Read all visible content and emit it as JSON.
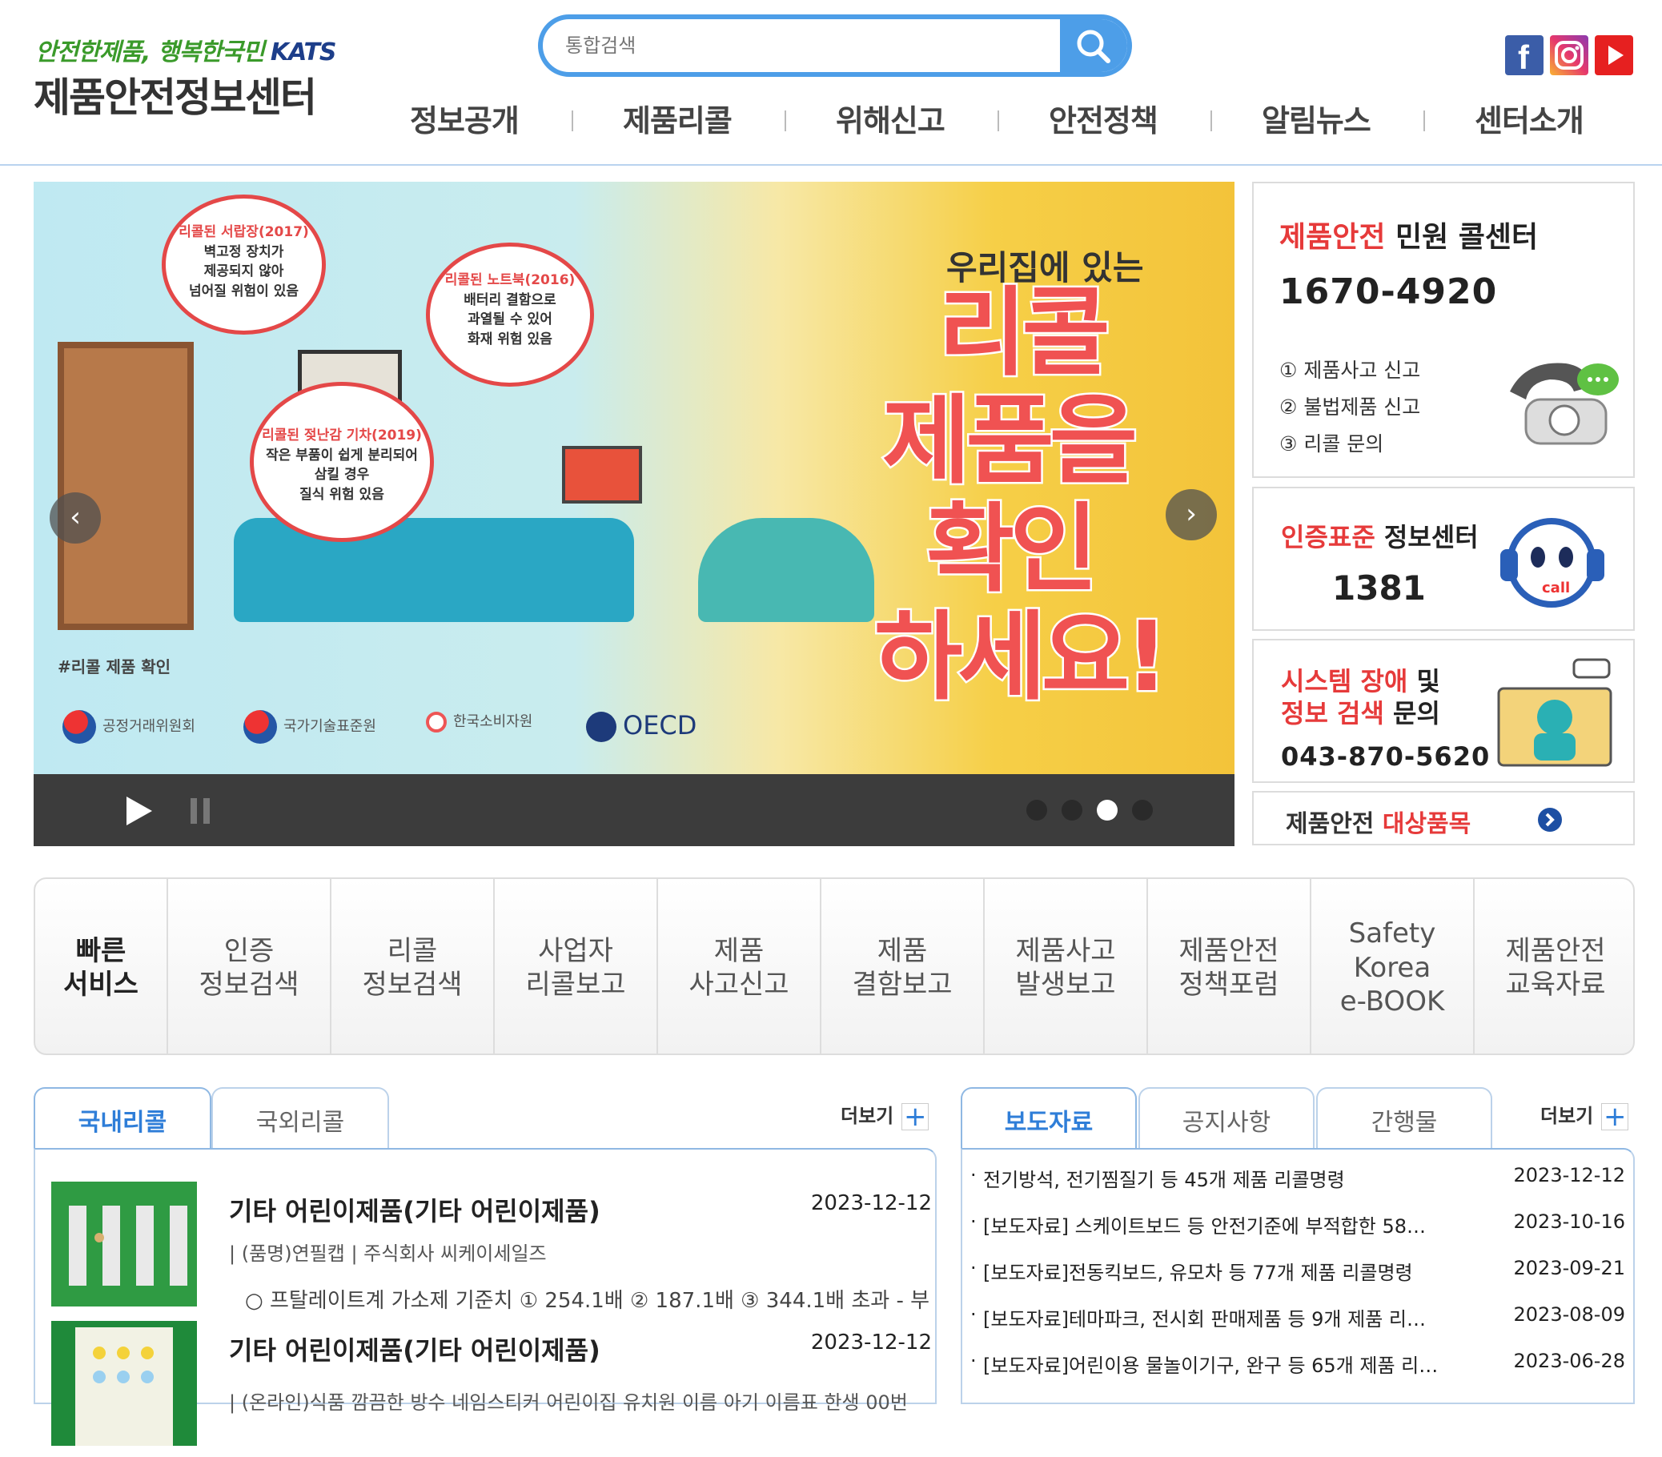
{
  "header": {
    "slogan": "안전한제품, 행복한국민",
    "slogan_brand": "KATS",
    "site_name": "제품안전정보센터",
    "search_placeholder": "통합검색",
    "sns": [
      "facebook-icon",
      "instagram-icon",
      "youtube-icon"
    ],
    "nav": [
      "정보공개",
      "제품리콜",
      "위해신고",
      "안전정책",
      "알림뉴스",
      "센터소개"
    ]
  },
  "banner": {
    "bubble1_red": "리콜된 서랍장(2017)",
    "bubble1_text": [
      "벽고정 장치가",
      "제공되지 않아",
      "넘어질 위험이 있음"
    ],
    "bubble2_red": "리콜된 노트북(2016)",
    "bubble2_text": [
      "배터리 결함으로",
      "과열될 수 있어",
      "화재 위험 있음"
    ],
    "bubble3_red": "리콜된 젖난감 기차(2019)",
    "bubble3_text": [
      "작은 부품이 쉽게 분리되어",
      "삼킬 경우",
      "질식 위험 있음"
    ],
    "headline_small": "우리집에 있는",
    "headline_lines": [
      "리콜",
      "제품을",
      "확인",
      "하세요!"
    ],
    "tag": "#리콜 제품 확인",
    "logos": [
      "공정거래위원회",
      "국가기술표준원",
      "한국소비자원",
      "OECD"
    ],
    "active_slide": 3,
    "slide_count": 4
  },
  "callcenter": {
    "title_red": "제품안전",
    "title_rest": " 민원 콜센터",
    "phone": "1670-4920",
    "items": [
      "① 제품사고 신고",
      "② 불법제품 신고",
      "③ 리콜 문의"
    ]
  },
  "certcenter": {
    "title_red": "인증표준",
    "title_rest": " 정보센터",
    "phone": "1381"
  },
  "syscenter": {
    "line1_red": "시스템 장애",
    "line1_rest": " 및",
    "line2_red": "정보 검색",
    "line2_rest": " 문의",
    "phone": "043-870-5620"
  },
  "target_items": {
    "label_plain": "제품안전 ",
    "label_red": "대상품목"
  },
  "quick": {
    "title": [
      "빠른",
      "서비스"
    ],
    "items": [
      [
        "인증",
        "정보검색"
      ],
      [
        "리콜",
        "정보검색"
      ],
      [
        "사업자",
        "리콜보고"
      ],
      [
        "제품",
        "사고신고"
      ],
      [
        "제품",
        "결함보고"
      ],
      [
        "제품사고",
        "발생보고"
      ],
      [
        "제품안전",
        "정책포럼"
      ],
      [
        "Safety",
        "Korea",
        "e-BOOK"
      ],
      [
        "제품안전",
        "교육자료"
      ]
    ]
  },
  "recall_tabs": [
    "국내리콜",
    "국외리콜"
  ],
  "more_label": "더보기",
  "recalls": [
    {
      "title": "기타 어린이제품(기타 어린이제품)",
      "date": "2023-12-12",
      "sub": "| (품명)연필캡 | 주식회사 씨케이세일즈",
      "desc": "○ 프탈레이트계 가소제 기준치 ① 254.1배 ② 187.1배 ③ 344.1배 초과 - 부"
    },
    {
      "title": "기타 어린이제품(기타 어린이제품)",
      "date": "2023-12-12",
      "sub": "| (온라인)식품 깜끔한 방수 네임스티커 어린이집 유치원 이름 아기 이름표 한생 00번",
      "desc": ""
    }
  ],
  "news_tabs": [
    "보도자료",
    "공지사항",
    "간행물"
  ],
  "news": [
    {
      "title": "전기방석, 전기찜질기 등 45개 제품 리콜명령",
      "date": "2023-12-12"
    },
    {
      "title": "[보도자료] 스케이트보드 등 안전기준에 부적합한 58…",
      "date": "2023-10-16"
    },
    {
      "title": "[보도자료]전동킥보드, 유모차 등 77개 제품 리콜명령",
      "date": "2023-09-21"
    },
    {
      "title": "[보도자료]테마파크, 전시회 판매제품 등 9개 제품 리…",
      "date": "2023-08-09"
    },
    {
      "title": "[보도자료]어린이용 물놀이기구, 완구 등 65개 제품 리…",
      "date": "2023-06-28"
    }
  ]
}
